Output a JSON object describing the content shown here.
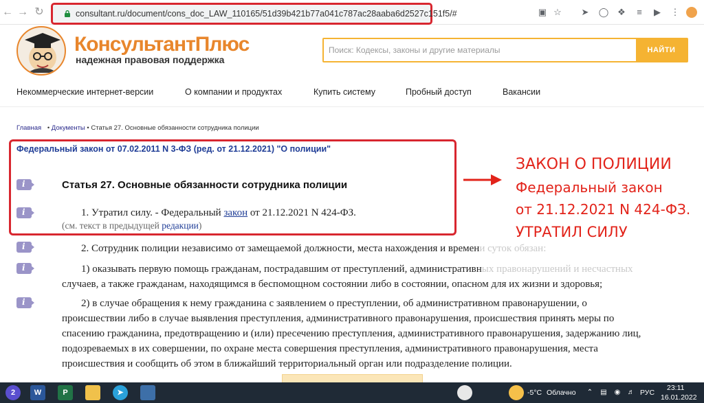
{
  "browser": {
    "url": "consultant.ru/document/cons_doc_LAW_110165/51d39b421b77a041c787ac28aaba6d2527c151f5/#",
    "back_icon": "arrow-left-icon",
    "forward_icon": "arrow-right-icon",
    "reload_icon": "reload-icon"
  },
  "site": {
    "logo_name": "КонсультантПлюс",
    "logo_tagline": "надежная правовая поддержка",
    "search_placeholder": "Поиск: Кодексы, законы и другие материалы",
    "search_button": "НАЙТИ",
    "accent_color": "#e8862c"
  },
  "menu": [
    "Некоммерческие интернет-версии",
    "О компании и продуктах",
    "Купить систему",
    "Пробный доступ",
    "Вакансии"
  ],
  "breadcrumb": {
    "home": "Главная",
    "sep1": "•",
    "docs": "Документы",
    "sep2": "•",
    "current": "Статья 27. Основные обязанности сотрудника полиции"
  },
  "document": {
    "law_title": "Федеральный закон от 07.02.2011 N 3-ФЗ (ред. от 21.12.2021) \"О полиции\"",
    "article_title": "Статья 27. Основные обязанности сотрудника полиции",
    "p1_start": "1. Утратил силу. - Федеральный ",
    "p1_link": "закон",
    "p1_end": " от 21.12.2021 N 424-ФЗ.",
    "p1_note_start": "(см. текст в предыдущей ",
    "p1_note_link": "редакции",
    "p1_note_end": ")",
    "p2_visible": "2. Сотрудник полиции независимо от замещаемой должности, места нахождения и времен",
    "p2_faded": "и суток обязан:",
    "p3_line1_visible": "1) оказывать первую помощь гражданам, пострадавшим от преступлений, административн",
    "p3_line1_faded": "ых правонарушений и несчастных",
    "p3_line2": "случаев, а также гражданам, находящимся в беспомощном состоянии либо в состоянии, опасном для их жизни и здоровья;",
    "p4_line1": "2) в случае обращения к нему гражданина с заявлением о преступлении, об административном правонарушении, о",
    "p4_line2": "происшествии либо в случае выявления преступления, административного правонарушения, происшествия принять меры по",
    "p4_line3": "спасению гражданина, предотвращению и (или) пресечению преступления, административного правонарушения, задержанию лиц,",
    "p4_line4": "подозреваемых в их совершении, по охране места совершения преступления, административного правонарушения, места",
    "p4_line5": "происшествия и сообщить об этом в ближайший территориальный орган или подразделение полиции."
  },
  "annotation": {
    "line1": "ЗАКОН О ПОЛИЦИИ",
    "line2": "Федеральный закон",
    "line3": "от 21.12.2021 N 424-ФЗ.",
    "line4": "УТРАТИЛ СИЛУ",
    "color": "#e2231a"
  },
  "taskbar": {
    "weather_temp": "-5°C",
    "weather_text": "Облачно",
    "lang": "РУС",
    "time": "23:11",
    "date": "16.01.2022",
    "notification_badge": "2"
  }
}
